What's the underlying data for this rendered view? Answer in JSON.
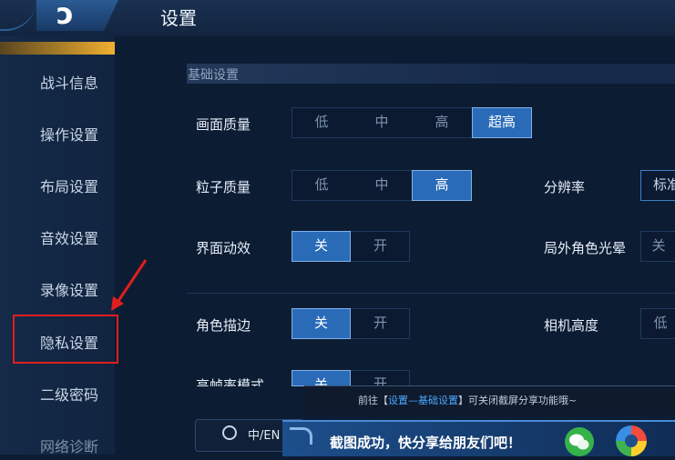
{
  "header": {
    "back_glyph": "ↄ",
    "title": "设置"
  },
  "sidebar": {
    "items": [
      {
        "label": "战斗信息"
      },
      {
        "label": "操作设置"
      },
      {
        "label": "布局设置"
      },
      {
        "label": "音效设置"
      },
      {
        "label": "录像设置"
      },
      {
        "label": "隐私设置"
      },
      {
        "label": "二级密码"
      },
      {
        "label": "网络诊断"
      }
    ]
  },
  "content": {
    "section_title": "基础设置",
    "picture_quality": {
      "label": "画面质量",
      "options": [
        "低",
        "中",
        "高",
        "超高"
      ],
      "selected": "超高"
    },
    "particle_quality": {
      "label": "粒子质量",
      "options": [
        "低",
        "中",
        "高"
      ],
      "selected": "高"
    },
    "resolution": {
      "label": "分辨率",
      "value": "标准"
    },
    "ui_animation": {
      "label": "界面动效",
      "options": [
        "关",
        "开"
      ],
      "selected": "关"
    },
    "outer_glow": {
      "label": "局外角色光晕",
      "value": "关"
    },
    "character_outline": {
      "label": "角色描边",
      "options": [
        "关",
        "开"
      ],
      "selected": "关"
    },
    "camera_height": {
      "label": "相机高度",
      "value": "低"
    },
    "high_frame": {
      "label": "高帧率模式",
      "options": [
        "关",
        "开"
      ]
    }
  },
  "hint_toast": {
    "prefix": "前往【",
    "link": "设置—基础设置",
    "suffix": "】可关闭截屏分享功能哦~"
  },
  "language_button": {
    "label": "中/EN"
  },
  "share_toast": {
    "message": "截图成功，快分享给朋友们吧！"
  },
  "colors": {
    "accent": "#2a6bb8",
    "highlight_box": "#e01e1e",
    "sidebar_accent": "#f0b030"
  }
}
